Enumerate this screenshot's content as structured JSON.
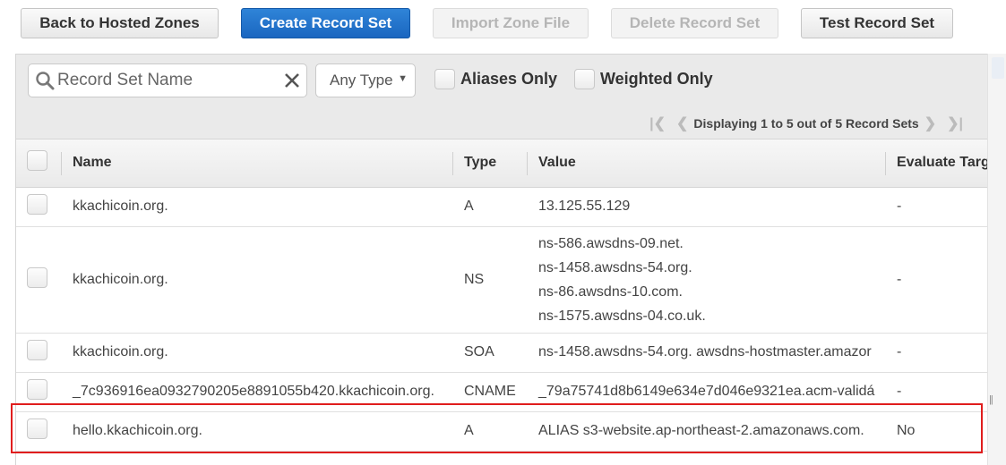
{
  "toolbar": {
    "back_label": "Back to Hosted Zones",
    "create_label": "Create Record Set",
    "import_label": "Import Zone File",
    "delete_label": "Delete Record Set",
    "test_label": "Test Record Set"
  },
  "filter": {
    "search_placeholder": "Record Set Name",
    "type_selected": "Any Type",
    "aliases_only_label": "Aliases Only",
    "weighted_only_label": "Weighted Only"
  },
  "pager": {
    "text": "Displaying 1 to 5 out of 5 Record Sets"
  },
  "table": {
    "columns": {
      "name": "Name",
      "type": "Type",
      "value": "Value",
      "evaluate": "Evaluate Targ"
    },
    "rows": [
      {
        "name": "kkachicoin.org.",
        "type": "A",
        "value": "13.125.55.129",
        "evaluate": "-"
      },
      {
        "name": "kkachicoin.org.",
        "type": "NS",
        "values": [
          "ns-586.awsdns-09.net.",
          "ns-1458.awsdns-54.org.",
          "ns-86.awsdns-10.com.",
          "ns-1575.awsdns-04.co.uk."
        ],
        "evaluate": "-"
      },
      {
        "name": "kkachicoin.org.",
        "type": "SOA",
        "value": "ns-1458.awsdns-54.org. awsdns-hostmaster.amazor",
        "evaluate": "-"
      },
      {
        "name": "_7c936916ea0932790205e8891055b420.kkachicoin.org.",
        "type": "CNAME",
        "value": "_79a75741d8b6149e634e7d046e9321ea.acm-validá",
        "evaluate": "-"
      },
      {
        "name": "hello.kkachicoin.org.",
        "type": "A",
        "value": "ALIAS s3-website.ap-northeast-2.amazonaws.com.",
        "evaluate": "No"
      }
    ]
  },
  "colors": {
    "primary": "#1a66c0",
    "highlight": "#e01d1d"
  }
}
